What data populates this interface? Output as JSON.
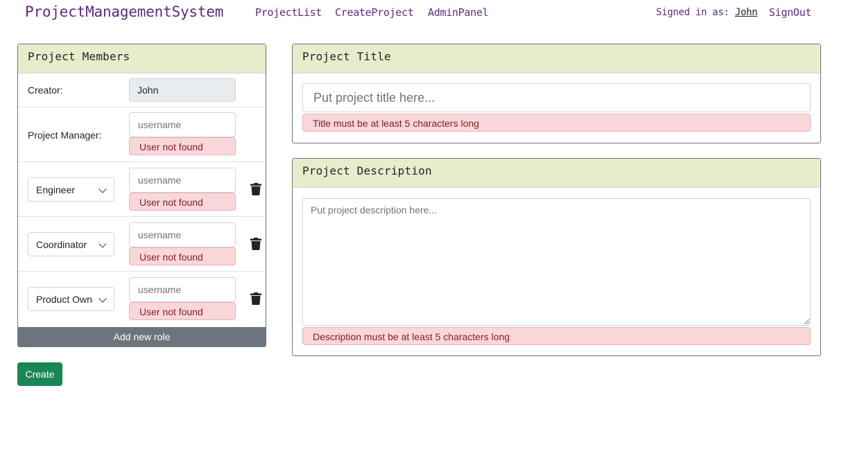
{
  "nav": {
    "brand": "ProjectManagementSystem",
    "links": [
      "ProjectList",
      "CreateProject",
      "AdminPanel"
    ],
    "signed_in_label": "Signed in as:",
    "user": "John",
    "signout": "SignOut"
  },
  "members": {
    "header": "Project Members",
    "creator_label": "Creator:",
    "creator_value": "John",
    "pm_label": "Project Manager:",
    "username_placeholder": "username",
    "error": "User not found",
    "roles": [
      "Engineer",
      "Coordinator",
      "Product Owner"
    ],
    "add_role": "Add new role"
  },
  "title_card": {
    "header": "Project Title",
    "placeholder": "Put project title here...",
    "error": "Title must be at least 5 characters long"
  },
  "desc_card": {
    "header": "Project Description",
    "placeholder": "Put project description here...",
    "error": "Description must be at least 5 characters long"
  },
  "create_button": "Create",
  "icons": {
    "delete": "trash-icon",
    "dropdown": "chevron-down-icon"
  }
}
